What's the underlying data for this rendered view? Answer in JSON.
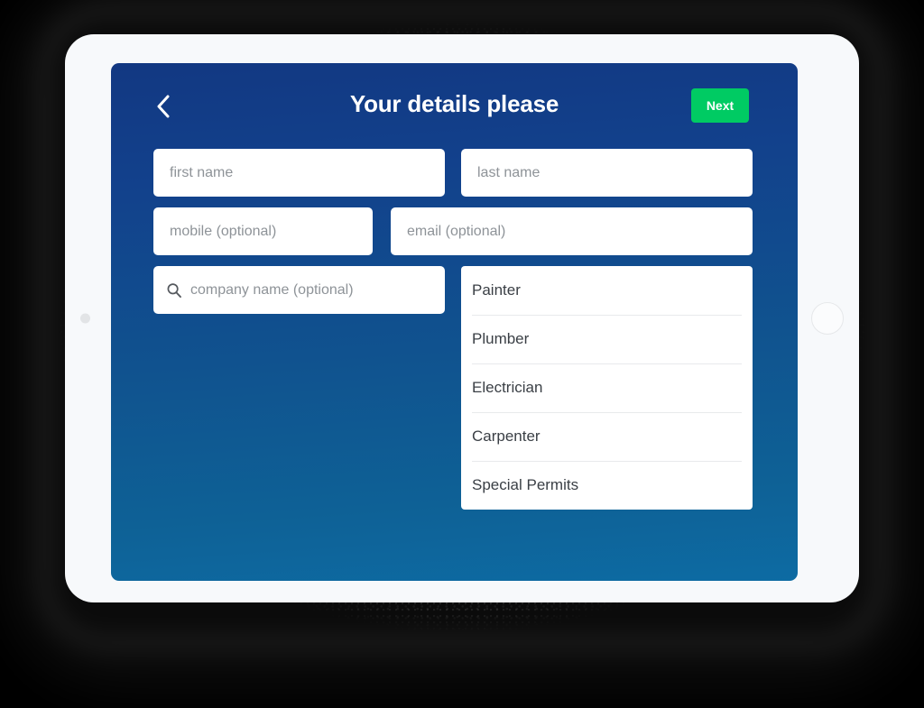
{
  "device": {
    "type": "tablet",
    "camera_icon": "camera-dot-icon",
    "home_button_icon": "home-button-icon"
  },
  "colors": {
    "brand_navy": "#123882",
    "brand_blue_bottom": "#0d6ba3",
    "accent_green": "#00cb63",
    "field_bg": "#ffffff",
    "placeholder_text": "#8e9398",
    "list_text": "#3a3f45",
    "page_background": "#000000"
  },
  "header": {
    "back_icon": "chevron-left-icon",
    "back_label": "Back",
    "title": "Your details please",
    "next_label": "Next"
  },
  "form": {
    "fields": [
      {
        "name": "first-name",
        "placeholder": "first name",
        "value": ""
      },
      {
        "name": "last-name",
        "placeholder": "last name",
        "value": ""
      },
      {
        "name": "mobile",
        "placeholder": "mobile (optional)",
        "value": ""
      },
      {
        "name": "email",
        "placeholder": "email (optional)",
        "value": ""
      },
      {
        "name": "company-name",
        "placeholder": "company name (optional)",
        "value": "",
        "icon": "search-icon"
      }
    ]
  },
  "trade_list": {
    "items": [
      {
        "label": "Painter"
      },
      {
        "label": "Plumber"
      },
      {
        "label": "Electrician"
      },
      {
        "label": "Carpenter"
      },
      {
        "label": "Special Permits"
      }
    ]
  }
}
